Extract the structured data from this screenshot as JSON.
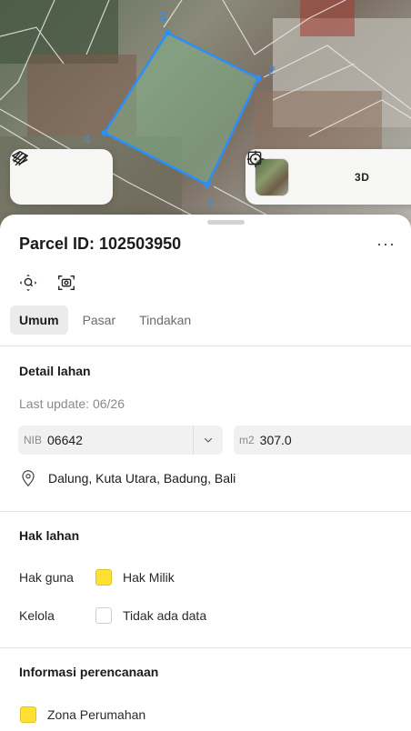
{
  "map": {
    "vertices": [
      "1",
      "2",
      "3",
      "4"
    ],
    "layers_button": "layers-icon",
    "draw_button": "draw-icon",
    "locate_button": "crosshair-icon",
    "view_3d_label": "3D",
    "accent_color": "#2b8ff7"
  },
  "sheet": {
    "title": "Parcel ID: 102503950",
    "more_label": "···",
    "tabs": [
      {
        "label": "Umum",
        "active": true
      },
      {
        "label": "Pasar",
        "active": false
      },
      {
        "label": "Tindakan",
        "active": false
      }
    ],
    "detail": {
      "heading": "Detail lahan",
      "last_update": "Last update: 06/26",
      "nib_prefix": "NIB",
      "nib_value": "06642",
      "area_unit": "m2",
      "area_value": "307.0",
      "address": "Dalung, Kuta Utara, Badung, Bali"
    },
    "rights": {
      "heading": "Hak lahan",
      "rows": [
        {
          "label": "Hak guna",
          "value": "Hak Milik",
          "color": "#ffe033"
        },
        {
          "label": "Kelola",
          "value": "Tidak ada data",
          "color": "#ffffff"
        }
      ]
    },
    "planning": {
      "heading": "Informasi perencanaan",
      "zone": "Zona Perumahan",
      "zone_color": "#ffe033"
    }
  }
}
